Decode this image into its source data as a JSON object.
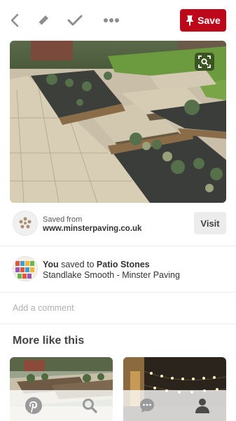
{
  "toolbar": {
    "back_icon": "back-arrow-icon",
    "edit_icon": "pencil-icon",
    "done_icon": "checkmark-icon",
    "more_icon": "more-dots-icon",
    "save_label": "Save",
    "save_icon": "pushpin-icon",
    "save_color": "#bd081c"
  },
  "pin": {
    "image_icon": "visual-search-icon"
  },
  "source": {
    "saved_from_label": "Saved from",
    "url": "www.minsterpaving.co.uk",
    "visit_label": "Visit"
  },
  "saver": {
    "you": "You",
    "action": "saved to",
    "board": "Patio Stones",
    "description": "Standlake Smooth - Minster Paving"
  },
  "comment": {
    "placeholder": "Add a comment"
  },
  "more": {
    "title": "More like this"
  },
  "nav": {
    "items": [
      "pinterest-logo-icon",
      "search-icon",
      "chat-bubble-icon",
      "profile-icon"
    ],
    "active": "profile-icon"
  }
}
